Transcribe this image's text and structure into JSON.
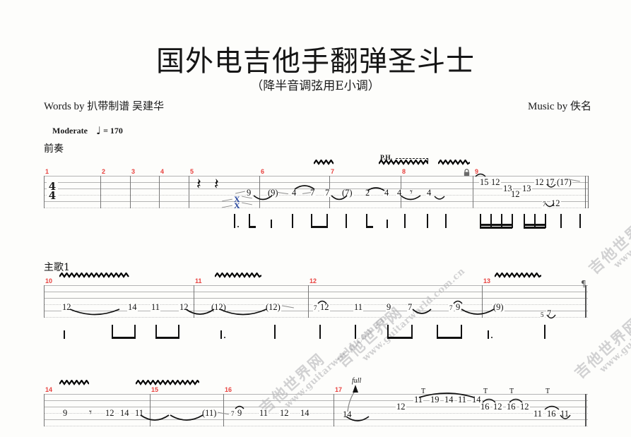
{
  "header": {
    "title": "国外电吉他手翻弹圣斗士",
    "subtitle": "（降半音调弦用E小调）",
    "credit_left": "Words by 扒带制谱 吴建华",
    "credit_right": "Music by 佚名",
    "tempo_word": "Moderate",
    "tempo_note": "♩",
    "tempo_value": "= 170",
    "time_signature_top": "4",
    "time_signature_bottom": "4"
  },
  "sections": [
    {
      "label": "前奏"
    },
    {
      "label": "主歌1"
    }
  ],
  "markings": {
    "palm_harmonic": "P.H.",
    "tap": "T",
    "bend_full": "full",
    "dead_note": "X",
    "pilcrow": "¶",
    "quarter_rest": "𝄽"
  },
  "watermark": {
    "cn": "吉他世界网",
    "url": "www.guitarworld.com.cn"
  },
  "colors": {
    "measure_number": "#e8423f",
    "staff_line": "#b4b4b4",
    "tab_number": "#141414",
    "dead_note": "#23439c",
    "page_bg": "#fdfdfb"
  },
  "systems": [
    {
      "name": "system-1",
      "measures": [
        "1",
        "2",
        "3",
        "4",
        "5",
        "6",
        "7",
        "8",
        "9"
      ],
      "tab_numbers": [
        "9",
        "(9)",
        "4",
        "7",
        "7",
        "(7)",
        "2",
        "4",
        "4",
        "4",
        "4",
        "15",
        "12",
        "13",
        "12",
        "13",
        "12",
        "17",
        "(17)",
        "7",
        "12"
      ]
    },
    {
      "name": "system-2",
      "measures": [
        "10",
        "11",
        "12",
        "13"
      ],
      "tab_numbers": [
        "12",
        "14",
        "11",
        "12",
        "(12)",
        "(12)",
        "7",
        "12",
        "11",
        "9",
        "7",
        "7",
        "9",
        "(9)",
        "5",
        "7"
      ]
    },
    {
      "name": "system-3",
      "measures": [
        "14",
        "15",
        "16",
        "17"
      ],
      "tab_numbers": [
        "9",
        "12",
        "14",
        "11",
        "(11)",
        "7",
        "9",
        "11",
        "12",
        "14",
        "14",
        "12",
        "11",
        "19",
        "14",
        "11",
        "14",
        "16",
        "12",
        "16",
        "12",
        "11",
        "16",
        "11"
      ]
    }
  ]
}
